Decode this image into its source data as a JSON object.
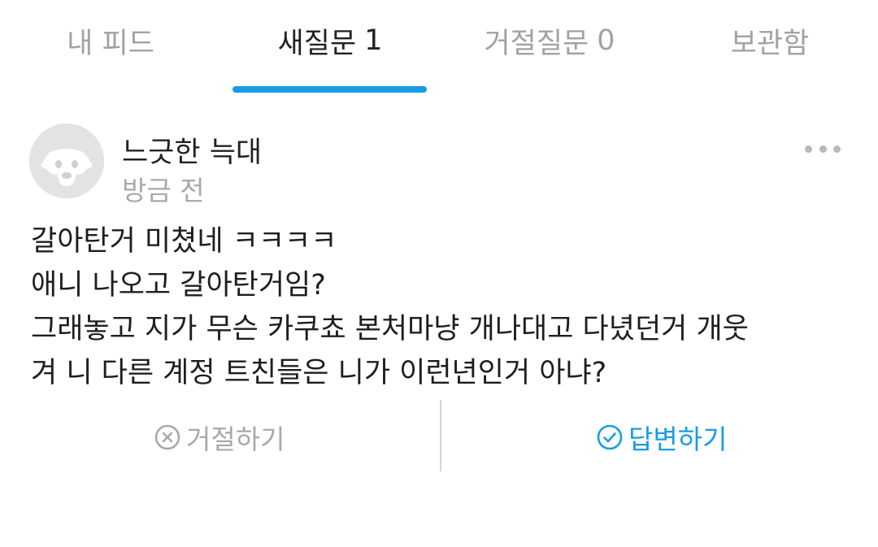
{
  "tabs": [
    {
      "label": "내 피드",
      "count": ""
    },
    {
      "label": "새질문",
      "count": "1"
    },
    {
      "label": "거절질문",
      "count": "0"
    },
    {
      "label": "보관함",
      "count": ""
    }
  ],
  "active_tab_index": 1,
  "question": {
    "author": "느긋한 늑대",
    "time": "방금 전",
    "lines": [
      "갈아탄거 미쳤네 ㅋㅋㅋㅋ",
      "애니 나오고 갈아탄거임?",
      "그래놓고 지가 무슨 카쿠쵸 본처마냥 개나대고 다녔던거 개웃",
      "겨 니 다른 계정 트친들은 니가 이런년인거 아냐?"
    ]
  },
  "actions": {
    "reject_label": "거절하기",
    "answer_label": "답변하기"
  },
  "icons": {
    "avatar": "dog-avatar-icon",
    "more": "more-horizontal-icon",
    "reject": "x-circle-icon",
    "answer": "check-circle-icon"
  },
  "colors": {
    "accent": "#1a9be6",
    "muted_text": "#a9a9a9",
    "primary_text": "#222222"
  }
}
